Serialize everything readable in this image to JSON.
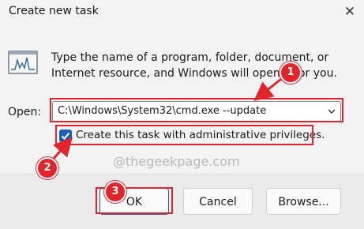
{
  "window": {
    "title": "Create new task",
    "close_glyph": "✕"
  },
  "description": "Type the name of a program, folder, document, or Internet resource, and Windows will open it for you.",
  "open": {
    "label": "Open:",
    "value": "C:\\Windows\\System32\\cmd.exe --update"
  },
  "admin_checkbox": {
    "label": "Create this task with administrative privileges.",
    "checked": true
  },
  "watermark": "@thegeekpage.com",
  "buttons": {
    "ok": "OK",
    "cancel": "Cancel",
    "browse": "Browse..."
  },
  "annotations": {
    "step1": "1",
    "step2": "2",
    "step3": "3",
    "color": "#e1252b"
  },
  "colors": {
    "accent": "#1a5fb4"
  }
}
